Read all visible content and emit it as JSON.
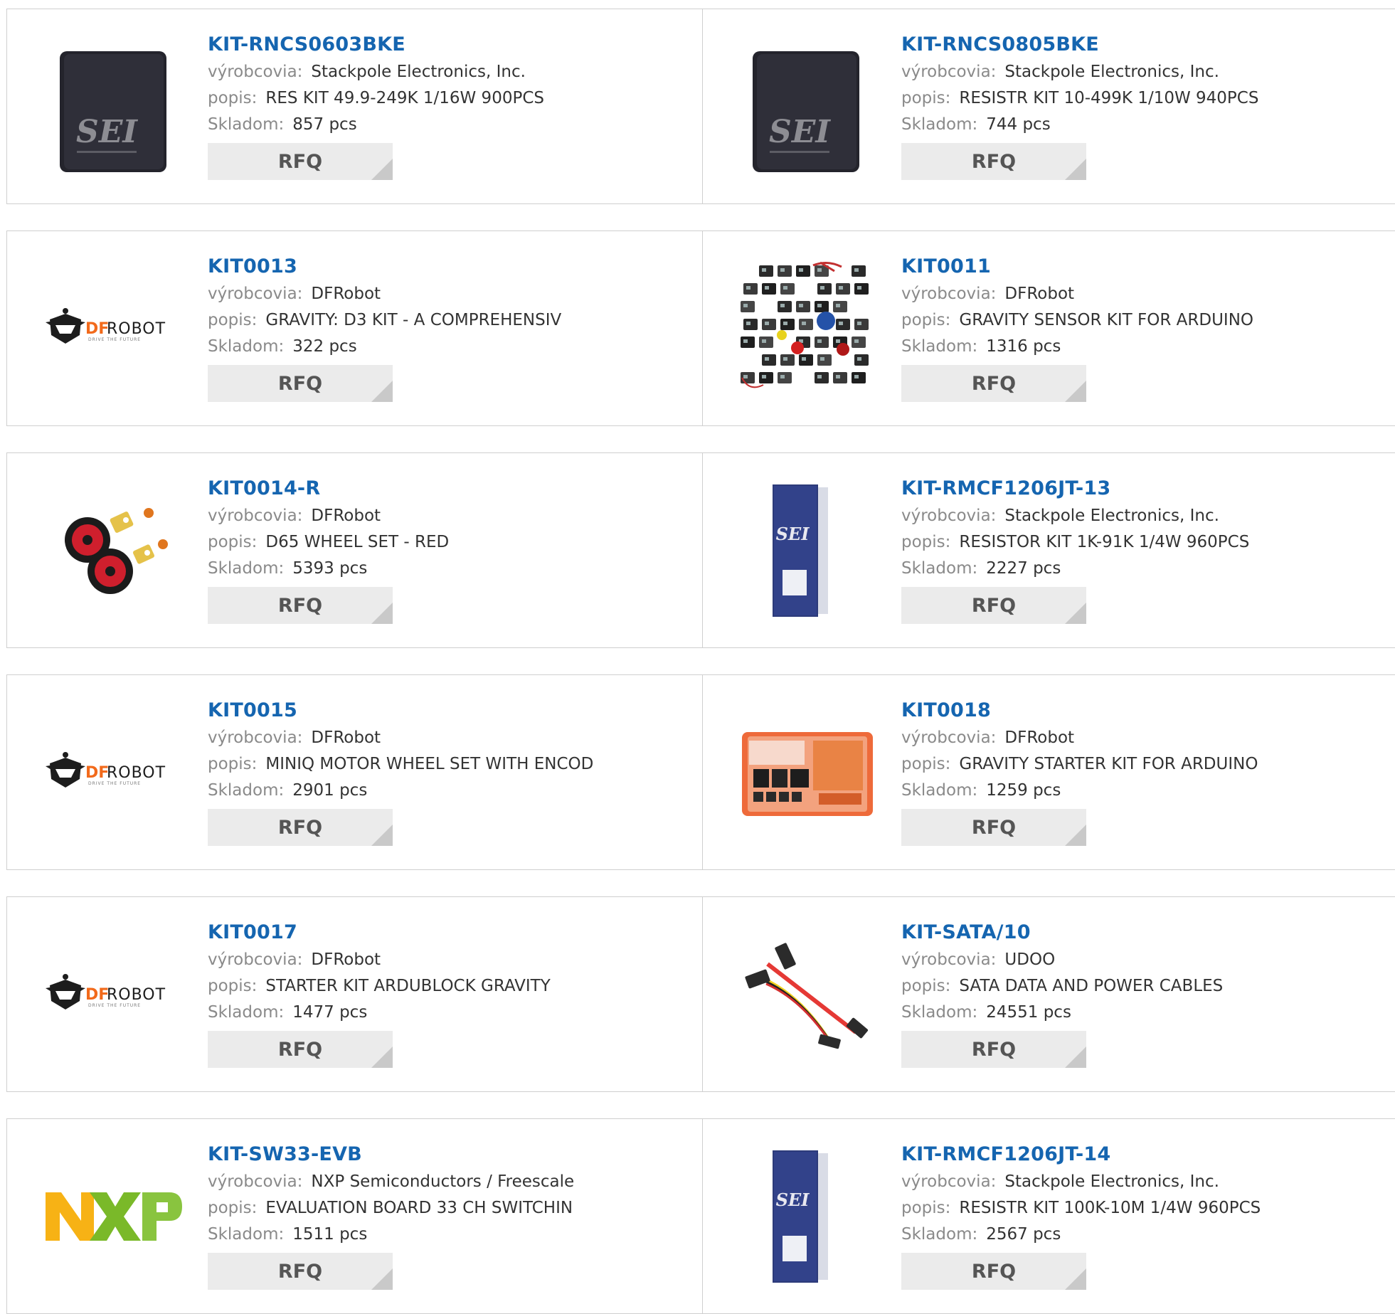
{
  "labels": {
    "manufacturer": "výrobcovia:",
    "description": "popis:",
    "stock": "Skladom:",
    "rfq": "RFQ"
  },
  "colors": {
    "title_link": "#1565b0",
    "label": "#8a8a8a",
    "rfq_bg": "#ebebeb",
    "border": "#cfcfcf"
  },
  "products": [
    {
      "part": "KIT-RNCS0603BKE",
      "manufacturer": "Stackpole Electronics, Inc.",
      "description": "RES KIT 49.9-249K 1/16W 900PCS",
      "stock": "857 pcs",
      "image": "sei-binder-black",
      "logo_text": "SEI"
    },
    {
      "part": "KIT-RNCS0805BKE",
      "manufacturer": "Stackpole Electronics, Inc.",
      "description": "RESISTR KIT 10-499K 1/10W 940PCS",
      "stock": "744 pcs",
      "image": "sei-binder-black",
      "logo_text": "SEI"
    },
    {
      "part": "KIT0013",
      "manufacturer": "DFRobot",
      "description": "GRAVITY: D3 KIT - A COMPREHENSIV",
      "stock": "322 pcs",
      "image": "dfrobot-logo",
      "logo_text": "DFROBOT"
    },
    {
      "part": "KIT0011",
      "manufacturer": "DFRobot",
      "description": "GRAVITY SENSOR KIT FOR ARDUINO",
      "stock": "1316 pcs",
      "image": "sensor-modules-photo"
    },
    {
      "part": "KIT0014-R",
      "manufacturer": "DFRobot",
      "description": "D65 WHEEL SET - RED",
      "stock": "5393 pcs",
      "image": "red-wheels-photo"
    },
    {
      "part": "KIT-RMCF1206JT-13",
      "manufacturer": "Stackpole Electronics, Inc.",
      "description": "RESISTOR KIT 1K-91K 1/4W 960PCS",
      "stock": "2227 pcs",
      "image": "sei-binder-blue",
      "logo_text": "SEI"
    },
    {
      "part": "KIT0015",
      "manufacturer": "DFRobot",
      "description": "MINIQ MOTOR WHEEL SET WITH ENCOD",
      "stock": "2901 pcs",
      "image": "dfrobot-logo",
      "logo_text": "DFROBOT"
    },
    {
      "part": "KIT0018",
      "manufacturer": "DFRobot",
      "description": "GRAVITY STARTER KIT FOR ARDUINO",
      "stock": "1259 pcs",
      "image": "orange-kit-box-photo"
    },
    {
      "part": "KIT0017",
      "manufacturer": "DFRobot",
      "description": "STARTER KIT ARDUBLOCK GRAVITY",
      "stock": "1477 pcs",
      "image": "dfrobot-logo",
      "logo_text": "DFROBOT"
    },
    {
      "part": "KIT-SATA/10",
      "manufacturer": "UDOO",
      "description": "SATA DATA AND POWER CABLES",
      "stock": "24551 pcs",
      "image": "sata-cables-photo"
    },
    {
      "part": "KIT-SW33-EVB",
      "manufacturer": "NXP Semiconductors / Freescale",
      "description": "EVALUATION BOARD 33 CH SWITCHIN",
      "stock": "1511 pcs",
      "image": "nxp-logo",
      "logo_text": "NXP"
    },
    {
      "part": "KIT-RMCF1206JT-14",
      "manufacturer": "Stackpole Electronics, Inc.",
      "description": "RESISTR KIT 100K-10M 1/4W 960PCS",
      "stock": "2567 pcs",
      "image": "sei-binder-blue",
      "logo_text": "SEI"
    }
  ]
}
